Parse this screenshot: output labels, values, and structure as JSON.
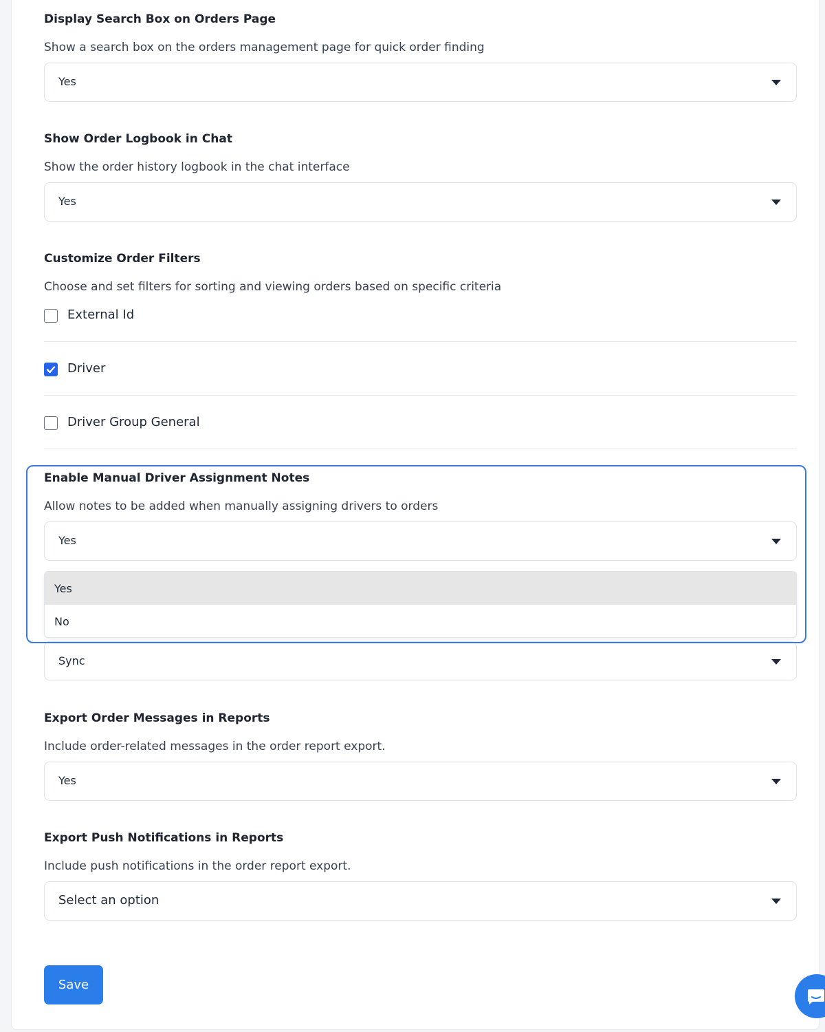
{
  "sections": {
    "search_box": {
      "title": "Display Search Box on Orders Page",
      "description": "Show a search box on the orders management page for quick order finding",
      "value": "Yes"
    },
    "logbook": {
      "title": "Show Order Logbook in Chat",
      "description": "Show the order history logbook in the chat interface",
      "value": "Yes"
    },
    "filters": {
      "title": "Customize Order Filters",
      "description": "Choose and set filters for sorting and viewing orders based on specific criteria",
      "options": [
        {
          "label": "External Id",
          "checked": false
        },
        {
          "label": "Driver",
          "checked": true
        },
        {
          "label": "Driver Group General",
          "checked": false
        }
      ]
    },
    "manual_notes": {
      "title": "Enable Manual Driver Assignment Notes",
      "description": "Allow notes to be added when manually assigning drivers to orders",
      "value": "Yes",
      "dropdown_options": [
        "Yes",
        "No"
      ],
      "highlighted_option": "Yes"
    },
    "sync": {
      "value": "Sync"
    },
    "export_messages": {
      "title": "Export Order Messages in Reports",
      "description": "Include order-related messages in the order report export.",
      "value": "Yes"
    },
    "export_push": {
      "title": "Export Push Notifications in Reports",
      "description": "Include push notifications in the order report export.",
      "value": "Select an option"
    }
  },
  "actions": {
    "save_label": "Save"
  },
  "colors": {
    "accent": "#2b7de9",
    "focus_outline": "#3b78e7",
    "checkbox_checked": "#2563eb",
    "option_highlight": "#e6e6e6"
  },
  "icons": {
    "select_caret": "caret-down-icon",
    "checkbox_check": "check-icon",
    "chat": "chat-bubble-icon"
  }
}
